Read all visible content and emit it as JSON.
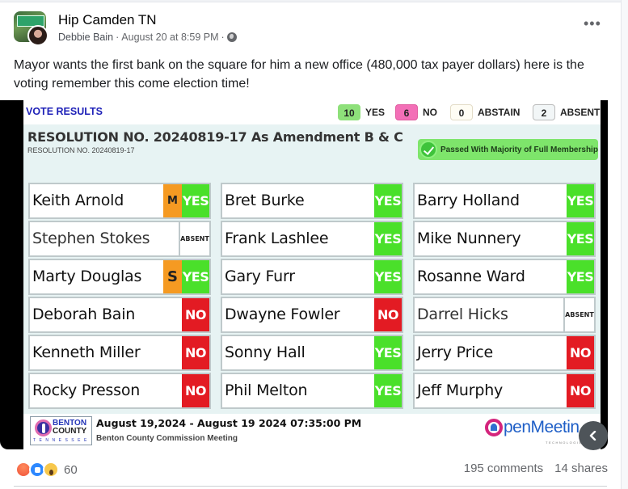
{
  "post": {
    "page_name": "Hip Camden TN",
    "author": "Debbie Bain",
    "timestamp": "August 20 at 8:59 PM",
    "separator": "·",
    "privacy_icon": "globe-icon",
    "more_icon": "more-options-icon",
    "text": "Mayor wants the first bank on the square for him a new office (480,000 tax payer dollars) here is the voting remember this come election time!"
  },
  "vote_screen": {
    "header_title": "VOTE RESULTS",
    "tallies": {
      "yes": {
        "count": "10",
        "label": "YES"
      },
      "no": {
        "count": "6",
        "label": "NO"
      },
      "abstain": {
        "count": "0",
        "label": "ABSTAIN"
      },
      "absent": {
        "count": "2",
        "label": "ABSENT"
      }
    },
    "resolution_title": "RESOLUTION NO. 20240819-17 As Amendment B & C",
    "resolution_subtitle": "RESOLUTION NO. 20240819-17",
    "status": "Passed With Majority of Full Membership",
    "members": [
      {
        "name": "Keith Arnold",
        "tag": "M",
        "vote": "YES"
      },
      {
        "name": "Bret Burke",
        "tag": "",
        "vote": "YES"
      },
      {
        "name": "Barry Holland",
        "tag": "",
        "vote": "YES"
      },
      {
        "name": "Stephen Stokes",
        "tag": "",
        "vote": "ABSENT"
      },
      {
        "name": "Frank Lashlee",
        "tag": "",
        "vote": "YES"
      },
      {
        "name": "Mike Nunnery",
        "tag": "",
        "vote": "YES"
      },
      {
        "name": "Marty Douglas",
        "tag": "S",
        "vote": "YES"
      },
      {
        "name": "Gary Furr",
        "tag": "",
        "vote": "YES"
      },
      {
        "name": "Rosanne Ward",
        "tag": "",
        "vote": "YES"
      },
      {
        "name": "Deborah Bain",
        "tag": "",
        "vote": "NO"
      },
      {
        "name": "Dwayne Fowler",
        "tag": "",
        "vote": "NO"
      },
      {
        "name": "Darrel Hicks",
        "tag": "",
        "vote": "ABSENT"
      },
      {
        "name": "Kenneth Miller",
        "tag": "",
        "vote": "NO"
      },
      {
        "name": "Sonny Hall",
        "tag": "",
        "vote": "YES"
      },
      {
        "name": "Jerry Price",
        "tag": "",
        "vote": "NO"
      },
      {
        "name": "Rocky Presson",
        "tag": "",
        "vote": "NO"
      },
      {
        "name": "Phil Melton",
        "tag": "",
        "vote": "YES"
      },
      {
        "name": "Jeff Murphy",
        "tag": "",
        "vote": "NO"
      }
    ],
    "footer": {
      "logo_line1": "BENTON",
      "logo_line2": "COUNTY",
      "logo_line3": "TENNESSEE",
      "meeting_datetime": "August 19,2024 - August 19 2024 07:35:00 PM",
      "meeting_name": "Benton County Commission Meeting",
      "vendor_logo": "OpenMeeting",
      "vendor_logo_visible": "penMeetin",
      "vendor_sub": "TECHNOLOGIES"
    },
    "colors": {
      "yes": "#4ae02a",
      "no": "#e31b23",
      "motion_second": "#f59a22",
      "title_blue": "#1f22b8",
      "passed_green": "#7ee56b"
    }
  },
  "engagement": {
    "reactions": [
      "angry",
      "like",
      "wow"
    ],
    "reaction_count": "60",
    "comments": "195 comments",
    "shares": "14 shares"
  },
  "carousel": {
    "prev_icon": "chevron-left-icon"
  }
}
